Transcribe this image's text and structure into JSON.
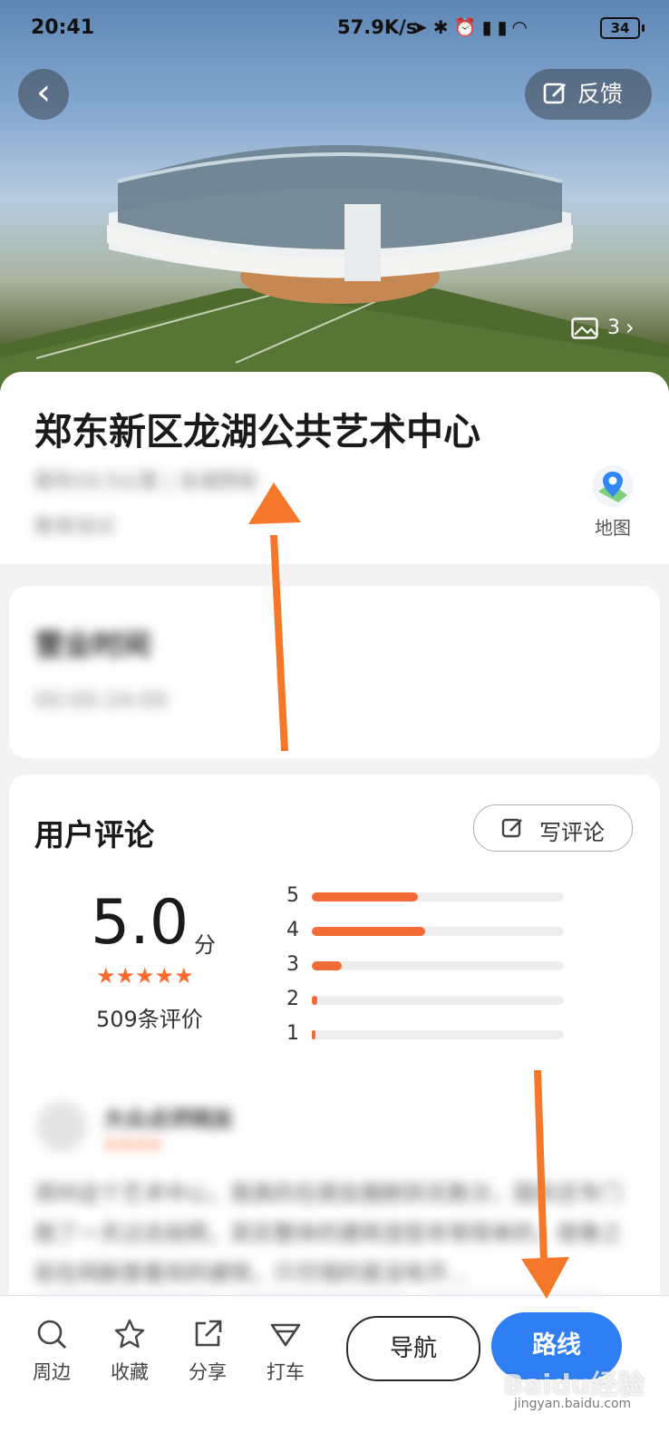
{
  "status_bar": {
    "time": "20:41",
    "net_speed": "57.9K/s",
    "icons": [
      "location-icon",
      "bluetooth-icon",
      "alarm-icon",
      "signal-icon",
      "signal-hd-icon",
      "wifi-icon"
    ],
    "battery": "34"
  },
  "header": {
    "feedback_label": "反馈",
    "photo_count": "3"
  },
  "poi": {
    "title": "郑东新区龙湖公共艺术中心",
    "meta": "距你10.5公里 | 龙湖西街",
    "category": "教育培训",
    "map_label": "地图"
  },
  "hours": {
    "title": "营业时间",
    "value": "00:00-24:00"
  },
  "reviews": {
    "title": "用户评论",
    "write_label": "写评论",
    "score": "5.0",
    "score_unit": "分",
    "stars": "★★★★★",
    "count_text": "509条评价",
    "distribution": [
      {
        "star": "5",
        "fraction": 0.42
      },
      {
        "star": "4",
        "fraction": 0.45
      },
      {
        "star": "3",
        "fraction": 0.12
      },
      {
        "star": "2",
        "fraction": 0.02
      },
      {
        "star": "1",
        "fraction": 0.01
      }
    ],
    "first_review": {
      "author": "大众点评网友",
      "stars": "★★★★",
      "text": "郑州这个艺术中心，我真的在朋友圈刷到无数次，国庆还专门跑了一天过去拍照，其实整体的建筑造型非常简单的，很像之前在网剧里看到的建筑，只可惜的是没有开..."
    }
  },
  "bottom_bar": {
    "tabs": [
      {
        "label": "周边",
        "icon": "search-icon"
      },
      {
        "label": "收藏",
        "icon": "star-icon"
      },
      {
        "label": "分享",
        "icon": "share-icon"
      },
      {
        "label": "打车",
        "icon": "taxi-icon"
      }
    ],
    "nav_label": "导航",
    "route_label": "路线"
  },
  "watermark": {
    "text": "Baidu经验",
    "sub": "jingyan.baidu.com"
  },
  "colors": {
    "accent_orange": "#f26a36",
    "route_blue": "#2f7ef3",
    "annotation_arrow": "#f4772a"
  }
}
